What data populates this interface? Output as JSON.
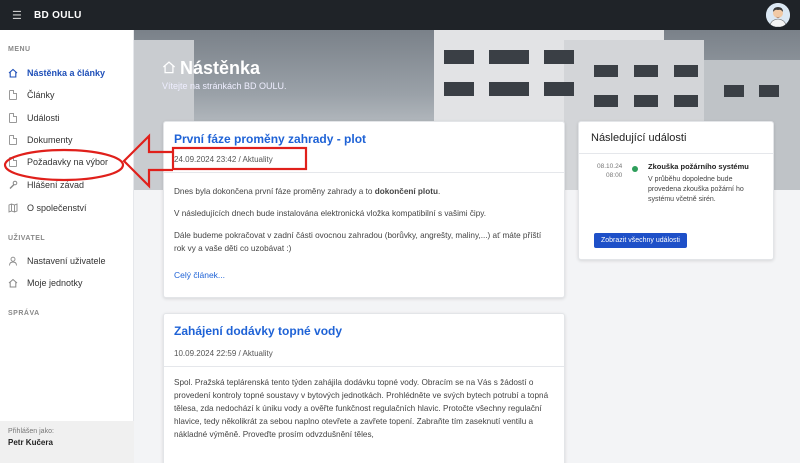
{
  "app": {
    "brand": "BD OULU",
    "menu_icon": "hamburger-icon"
  },
  "sidebar": {
    "sections": [
      {
        "label": "MENU"
      },
      {
        "label": "UŽIVATEL"
      },
      {
        "label": "SPRÁVA"
      }
    ],
    "items": [
      {
        "label": "Nástěnka a články",
        "icon": "home-icon",
        "active": true
      },
      {
        "label": "Články",
        "icon": "document-icon"
      },
      {
        "label": "Události",
        "icon": "document-icon"
      },
      {
        "label": "Dokumenty",
        "icon": "document-icon"
      },
      {
        "label": "Požadavky na výbor",
        "icon": "document-icon"
      },
      {
        "label": "Hlášení závad",
        "icon": "wrench-icon"
      },
      {
        "label": "O společenství",
        "icon": "map-icon"
      },
      {
        "label": "Nastavení uživatele",
        "icon": "user-icon"
      },
      {
        "label": "Moje jednotky",
        "icon": "home-icon"
      }
    ],
    "footer": {
      "label": "Přihlášen jako:",
      "user": "Petr Kučera"
    }
  },
  "hero": {
    "title": "Nástěnka",
    "subtitle": "Vítejte na stránkách BD OULU."
  },
  "posts": [
    {
      "title": "První fáze proměny zahrady - plot",
      "meta": "24.09.2024 23:42 / Aktuality",
      "p1_before": "Dnes byla dokončena první fáze proměny zahrady a to ",
      "p1_bold": "dokončení plotu",
      "p1_after": ".",
      "p2": "V následujících dnech bude instalována elektronická vložka kompatibilní s vašimi čipy.",
      "p3": "Dále budeme pokračovat v zadní části ovocnou zahradou (borůvky, angrešty, maliny,...) ať máte příští rok vy a vaše děti co uzobávat :)",
      "more": "Celý článek..."
    },
    {
      "title": "Zahájení dodávky topné vody",
      "meta": "10.09.2024 22:59 / Aktuality",
      "p1": "Spol. Pražská teplárenská tento týden zahájila dodávku topné vody. Obracím se na Vás s žádostí o provedení kontroly topné soustavy v bytových jednotkách. Prohlédněte ve svých bytech potrubí a topná tělesa, zda nedochází k úniku vody a ověřte funkčnost regulačních hlavic. Protočte všechny regulační hlavice, tedy několikrát za sebou naplno otevřete a zavřete topení. Zabraňte tím zaseknutí ventilu a nákladné výměně. Proveďte prosím  odvzdušnění těles,"
    }
  ],
  "events": {
    "title": "Následující události",
    "items": [
      {
        "date": "08.10.24",
        "time": "08:00",
        "name": "Zkouška požárního systému",
        "desc": "V průběhu dopoledne bude provedena zkouška požární ho systému včetně sirén."
      }
    ],
    "button": "Zobrazit všechny události"
  },
  "annotation_color": "#e0201b"
}
